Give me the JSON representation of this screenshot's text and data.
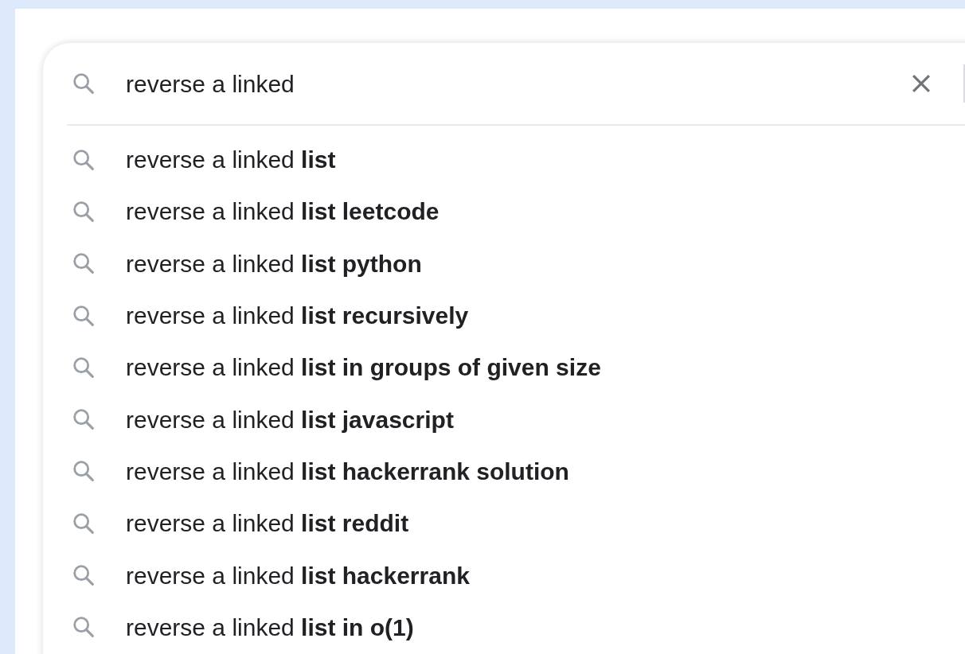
{
  "search": {
    "value": "reverse a linked"
  },
  "suggestions": [
    "reverse a linked **list**",
    "reverse a linked **list leetcode**",
    "reverse a linked **list python**",
    "reverse a linked **list recursively**",
    "reverse a linked **list in groups of given size**",
    "reverse a linked **list javascript**",
    "reverse a linked **list hackerrank solution**",
    "reverse a linked **list reddit**",
    "reverse a linked **list hackerrank**",
    "reverse a linked **list in o(1)**"
  ]
}
